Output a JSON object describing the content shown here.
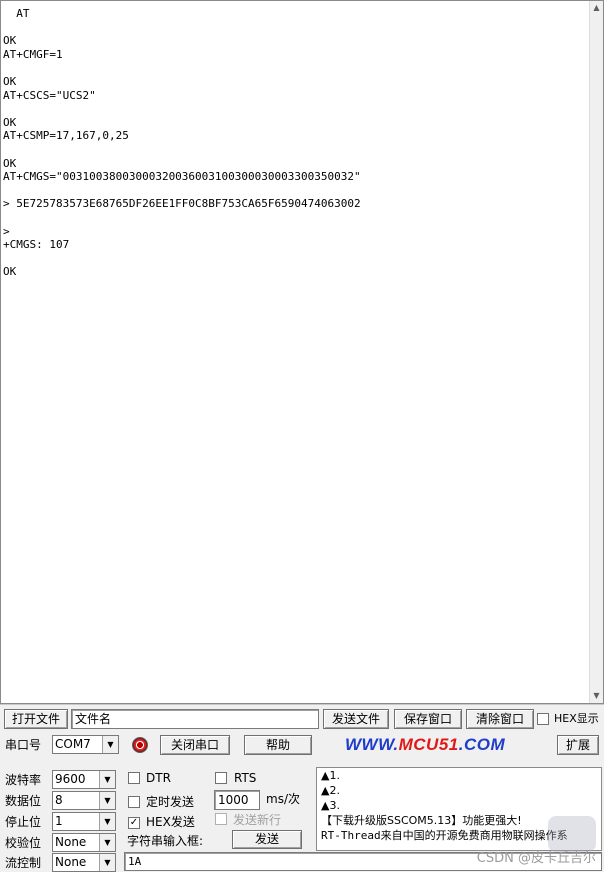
{
  "terminal": {
    "lines": [
      "  AT",
      "",
      "OK",
      "AT+CMGF=1",
      "",
      "OK",
      "AT+CSCS=\"UCS2\"",
      "",
      "OK",
      "AT+CSMP=17,167,0,25",
      "",
      "OK",
      "AT+CMGS=\"00310038003000320036003100300030003300350032\"",
      "",
      "> 5E725783573E68765DF26EE1FF0C8BF753CA65F6590474063002",
      "",
      ">",
      "+CMGS: 107",
      "",
      "OK"
    ]
  },
  "toolbar": {
    "open_file": "打开文件",
    "file_name": "文件名",
    "send_file": "发送文件",
    "save_window": "保存窗口",
    "clear_window": "清除窗口",
    "hex_display": "HEX显示"
  },
  "port_row": {
    "port_label": "串口号",
    "port_value": "COM7",
    "close_port": "关闭串口",
    "help": "帮助",
    "brand_a": "WWW.",
    "brand_b": "MCU51",
    "brand_c": ".COM",
    "expand": "扩展"
  },
  "settings": {
    "baud_label": "波特率",
    "baud_value": "9600",
    "data_label": "数据位",
    "data_value": "8",
    "stop_label": "停止位",
    "stop_value": "1",
    "parity_label": "校验位",
    "parity_value": "None",
    "flow_label": "流控制",
    "flow_value": "None"
  },
  "options": {
    "dtr": "DTR",
    "rts": "RTS",
    "timed_send": "定时发送",
    "interval": "1000",
    "interval_unit": "ms/次",
    "hex_send": "HEX发送",
    "send_newline": "发送新行",
    "input_label": "字符串输入框:",
    "send": "发送",
    "input_value": "1A"
  },
  "info": {
    "lines": [
      "▲1.",
      "▲2.",
      "▲3."
    ],
    "notice1": "【下载升级版SSCOM5.13】功能更强大!",
    "notice2": "RT-Thread来自中国的开源免费商用物联网操作系"
  },
  "watermark": "CSDN @皮卡丘吉尔",
  "colors": {
    "brand_blue": "#1f3dc9",
    "brand_red": "#e01818",
    "panel_bg": "#f0f0f0"
  }
}
